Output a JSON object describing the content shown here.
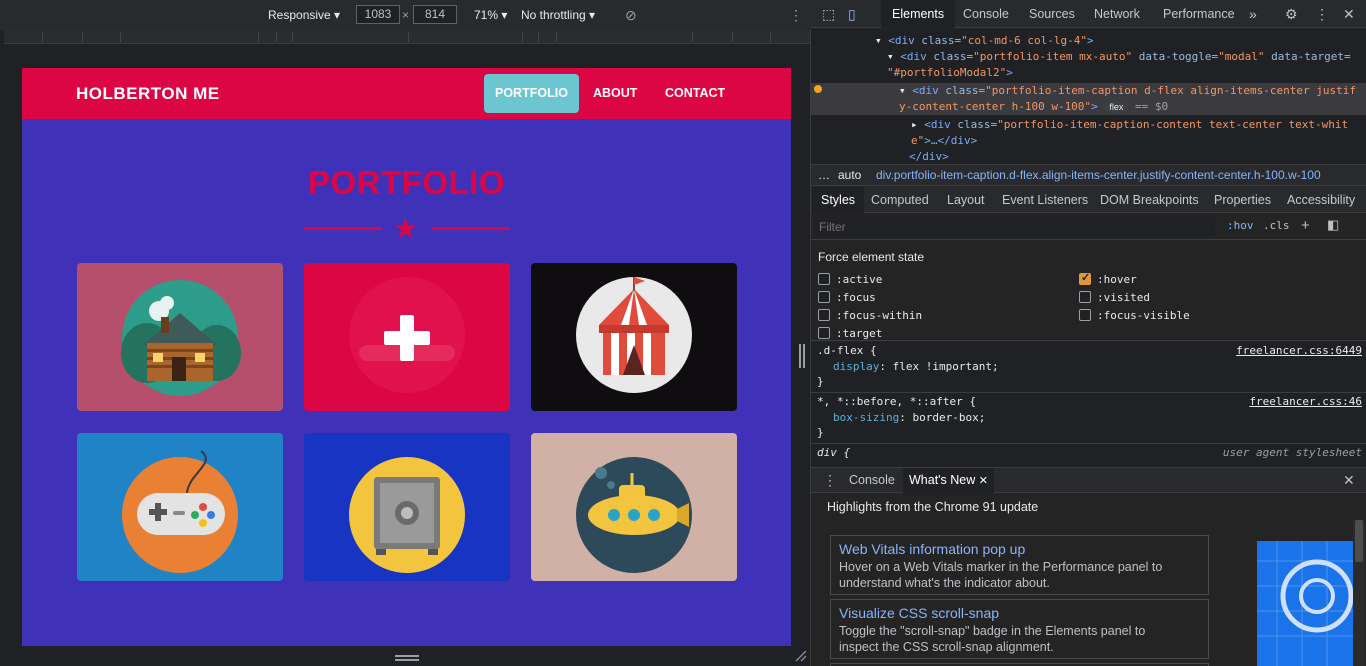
{
  "device_toolbar": {
    "mode": "Responsive",
    "width": "1083",
    "times": "×",
    "height": "814",
    "zoom": "71%",
    "throttling": "No throttling"
  },
  "site": {
    "brand": "HOLBERTON ME",
    "nav": [
      "PORTFOLIO",
      "ABOUT",
      "CONTACT"
    ],
    "active_nav": "PORTFOLIO",
    "section_title": "PORTFOLIO",
    "colors": {
      "primary": "#dd0644",
      "background": "#3f31b8",
      "active_link": "#6cc6d1"
    },
    "tiles": [
      {
        "name": "cabin",
        "icon": "cabin-icon",
        "bg": "#b54f6b"
      },
      {
        "name": "hover-overlay",
        "icon": "plus-icon",
        "bg": "#dd0644"
      },
      {
        "name": "circus-tent",
        "icon": "circus-tent-icon",
        "bg": "#100d10"
      },
      {
        "name": "game-controller",
        "icon": "game-controller-icon",
        "bg": "#1f83c6"
      },
      {
        "name": "safe",
        "icon": "safe-icon",
        "bg": "#1734c2"
      },
      {
        "name": "submarine",
        "icon": "submarine-icon",
        "bg": "#d1b1a6"
      }
    ]
  },
  "devtools": {
    "tabs": [
      "Elements",
      "Console",
      "Sources",
      "Network",
      "Performance"
    ],
    "more": "»",
    "dom": {
      "line1_tag": "<div",
      "line1_attr": "class=",
      "line1_val": "\"col-md-6 col-lg-4\"",
      "line1_end": ">",
      "line2_tag": "<div",
      "line2_attr1": "class=",
      "line2_val1": "\"portfolio-item mx-auto\"",
      "line2_attr2": "data-toggle=",
      "line2_val2": "\"modal\"",
      "line2_attr3": "data-target=",
      "line3_val": "\"#portfolioModal2\"",
      "line3_end": ">",
      "sel_tag": "<div",
      "sel_attr": "class=",
      "sel_val_a": "\"portfolio-item-caption d-flex align-items-center justif",
      "sel_val_b": "y-content-center h-100 w-100\"",
      "sel_end": ">",
      "sel_badge": "flex",
      "sel_eq": "== $0",
      "line5_tag": "<div",
      "line5_attr": "class=",
      "line5_val_a": "\"portfolio-item-caption-content text-center text-whit",
      "line5_val_b": "e\"",
      "line5_end": ">…</div>",
      "close": "</div>"
    },
    "breadcrumbs": {
      "dots": "…",
      "auto": "auto",
      "path": "div.portfolio-item-caption.d-flex.align-items-center.justify-content-center.h-100.w-100"
    },
    "style_tabs": [
      "Styles",
      "Computed",
      "Layout",
      "Event Listeners",
      "DOM Breakpoints",
      "Properties",
      "Accessibility"
    ],
    "filter_placeholder": "Filter",
    "hov": ":hov",
    "cls": ".cls",
    "force_title": "Force element state",
    "states": [
      {
        "label": ":active",
        "checked": false
      },
      {
        "label": ":focus",
        "checked": false
      },
      {
        "label": ":focus-within",
        "checked": false
      },
      {
        "label": ":target",
        "checked": false
      },
      {
        "label": ":hover",
        "checked": true
      },
      {
        "label": ":visited",
        "checked": false
      },
      {
        "label": ":focus-visible",
        "checked": false
      }
    ],
    "rules": {
      "r1_selector": ".d-flex {",
      "r1_source": "freelancer.css:6449",
      "r1_prop": "display",
      "r1_val": ": flex !important;",
      "r1_close": "}",
      "r2_selector": "*, *::before, *::after {",
      "r2_source": "freelancer.css:46",
      "r2_prop": "box-sizing",
      "r2_val": ": border-box;",
      "r2_close": "}",
      "r3_selector": "div {",
      "r3_source": "user agent stylesheet"
    },
    "drawer_tabs": [
      "Console",
      "What's New"
    ],
    "highlights": "Highlights from the Chrome 91 update",
    "cards": [
      {
        "title": "Web Vitals information pop up",
        "desc1": "Hover on a Web Vitals marker in the Performance panel to",
        "desc2": "understand what's the indicator about."
      },
      {
        "title": "Visualize CSS scroll-snap",
        "desc1": "Toggle the \"scroll-snap\" badge in the Elements panel to",
        "desc2": "inspect the CSS scroll-snap alignment."
      }
    ]
  }
}
